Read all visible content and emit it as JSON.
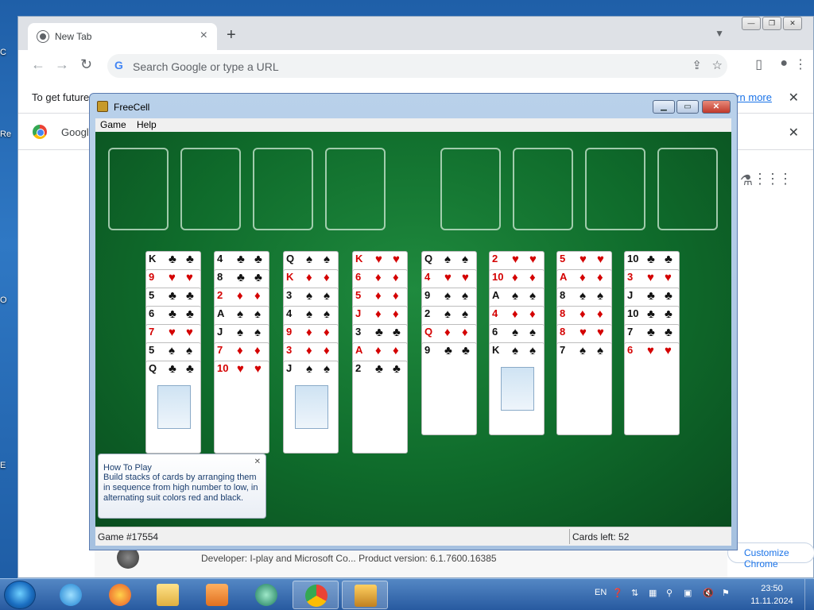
{
  "desktop": {
    "fragments": [
      "C",
      "Re",
      "O",
      "E"
    ]
  },
  "chrome": {
    "tab_title": "New Tab",
    "omnibox_placeholder": "Search Google or type a URL",
    "infobar_text": "To get future",
    "infobar_link": "Learn more",
    "google_text": "Googl",
    "developer_text": "Developer:  I-play and Microsoft Co...  Product version:  6.1.7600.16385",
    "customize_label": "Customize Chrome"
  },
  "freecell": {
    "title": "FreeCell",
    "menu": [
      "Game",
      "Help"
    ],
    "tip": {
      "heading": "How To Play",
      "body": "Build stacks of cards by arranging them in sequence from high number to low, in alternating suit colors red and black."
    },
    "status_game": "Game #17554",
    "status_cards": "Cards left: 52",
    "columns": [
      [
        "K♣",
        "9♥",
        "5♣",
        "6♣",
        "7♥",
        "5♠",
        "Q♣"
      ],
      [
        "4♣",
        "8♣",
        "2♦",
        "A♠",
        "J♠",
        "7♦",
        "10♥"
      ],
      [
        "Q♠",
        "K♦",
        "3♠",
        "4♠",
        "9♦",
        "3♦",
        "J♠"
      ],
      [
        "K♥",
        "6♦",
        "5♦",
        "J♦",
        "3♣",
        "A♦",
        "2♣"
      ],
      [
        "Q♠",
        "4♥",
        "9♠",
        "2♠",
        "Q♦",
        "9♣"
      ],
      [
        "2♥",
        "10♦",
        "A♠",
        "4♦",
        "6♠",
        "K♠"
      ],
      [
        "5♥",
        "A♦",
        "8♠",
        "8♦",
        "8♥",
        "7♠"
      ],
      [
        "10♣",
        "3♥",
        "J♣",
        "10♣",
        "7♣",
        "6♥"
      ]
    ]
  },
  "taskbar": {
    "lang": "EN",
    "time": "23:50",
    "date": "11.11.2024"
  }
}
